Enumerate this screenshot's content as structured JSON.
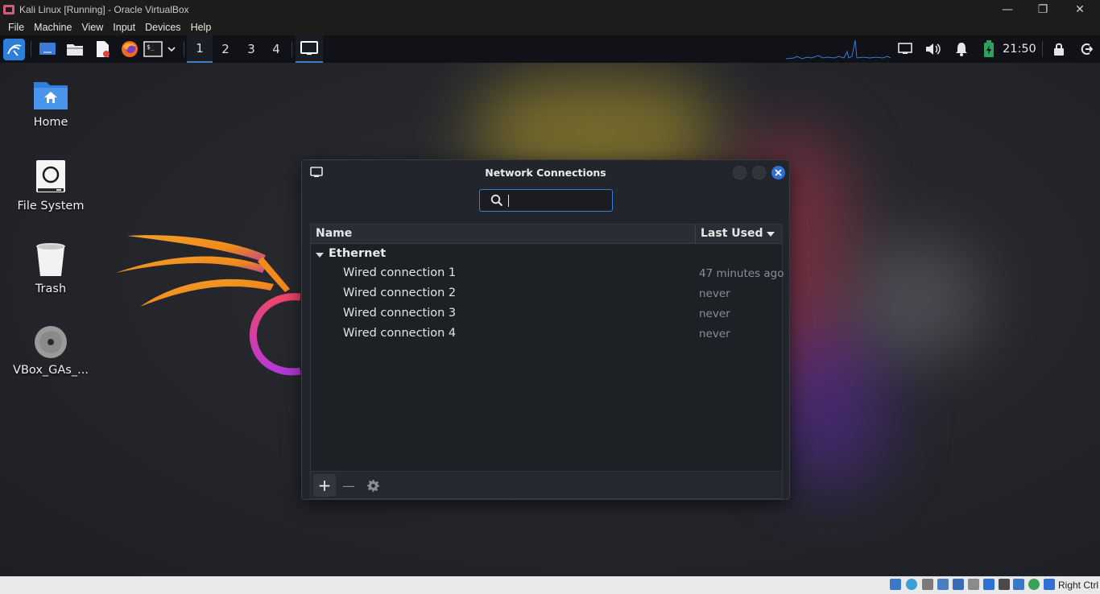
{
  "vbox": {
    "title": "Kali Linux [Running] - Oracle VirtualBox",
    "menu": [
      "File",
      "Machine",
      "View",
      "Input",
      "Devices",
      "Help"
    ],
    "host_key": "Right Ctrl"
  },
  "panel": {
    "workspaces": [
      "1",
      "2",
      "3",
      "4"
    ],
    "active_workspace": "1",
    "clock": "21:50"
  },
  "desktop": {
    "icons": [
      {
        "label": "Home",
        "icon": "home-folder-icon"
      },
      {
        "label": "File System",
        "icon": "drive-icon"
      },
      {
        "label": "Trash",
        "icon": "trash-icon"
      },
      {
        "label": "VBox_GAs_...",
        "icon": "cdrom-icon"
      }
    ]
  },
  "dialog": {
    "title": "Network Connections",
    "search": {
      "value": "",
      "placeholder": ""
    },
    "columns": {
      "name": "Name",
      "last_used": "Last Used"
    },
    "group": "Ethernet",
    "connections": [
      {
        "name": "Wired connection 1",
        "last_used": "47 minutes ago"
      },
      {
        "name": "Wired connection 2",
        "last_used": "never"
      },
      {
        "name": "Wired connection 3",
        "last_used": "never"
      },
      {
        "name": "Wired connection 4",
        "last_used": "never"
      }
    ],
    "toolbar": {
      "add": "+",
      "remove": "—"
    }
  },
  "colors": {
    "accent": "#3d7bd8",
    "close_button": "#2f6fd6"
  }
}
